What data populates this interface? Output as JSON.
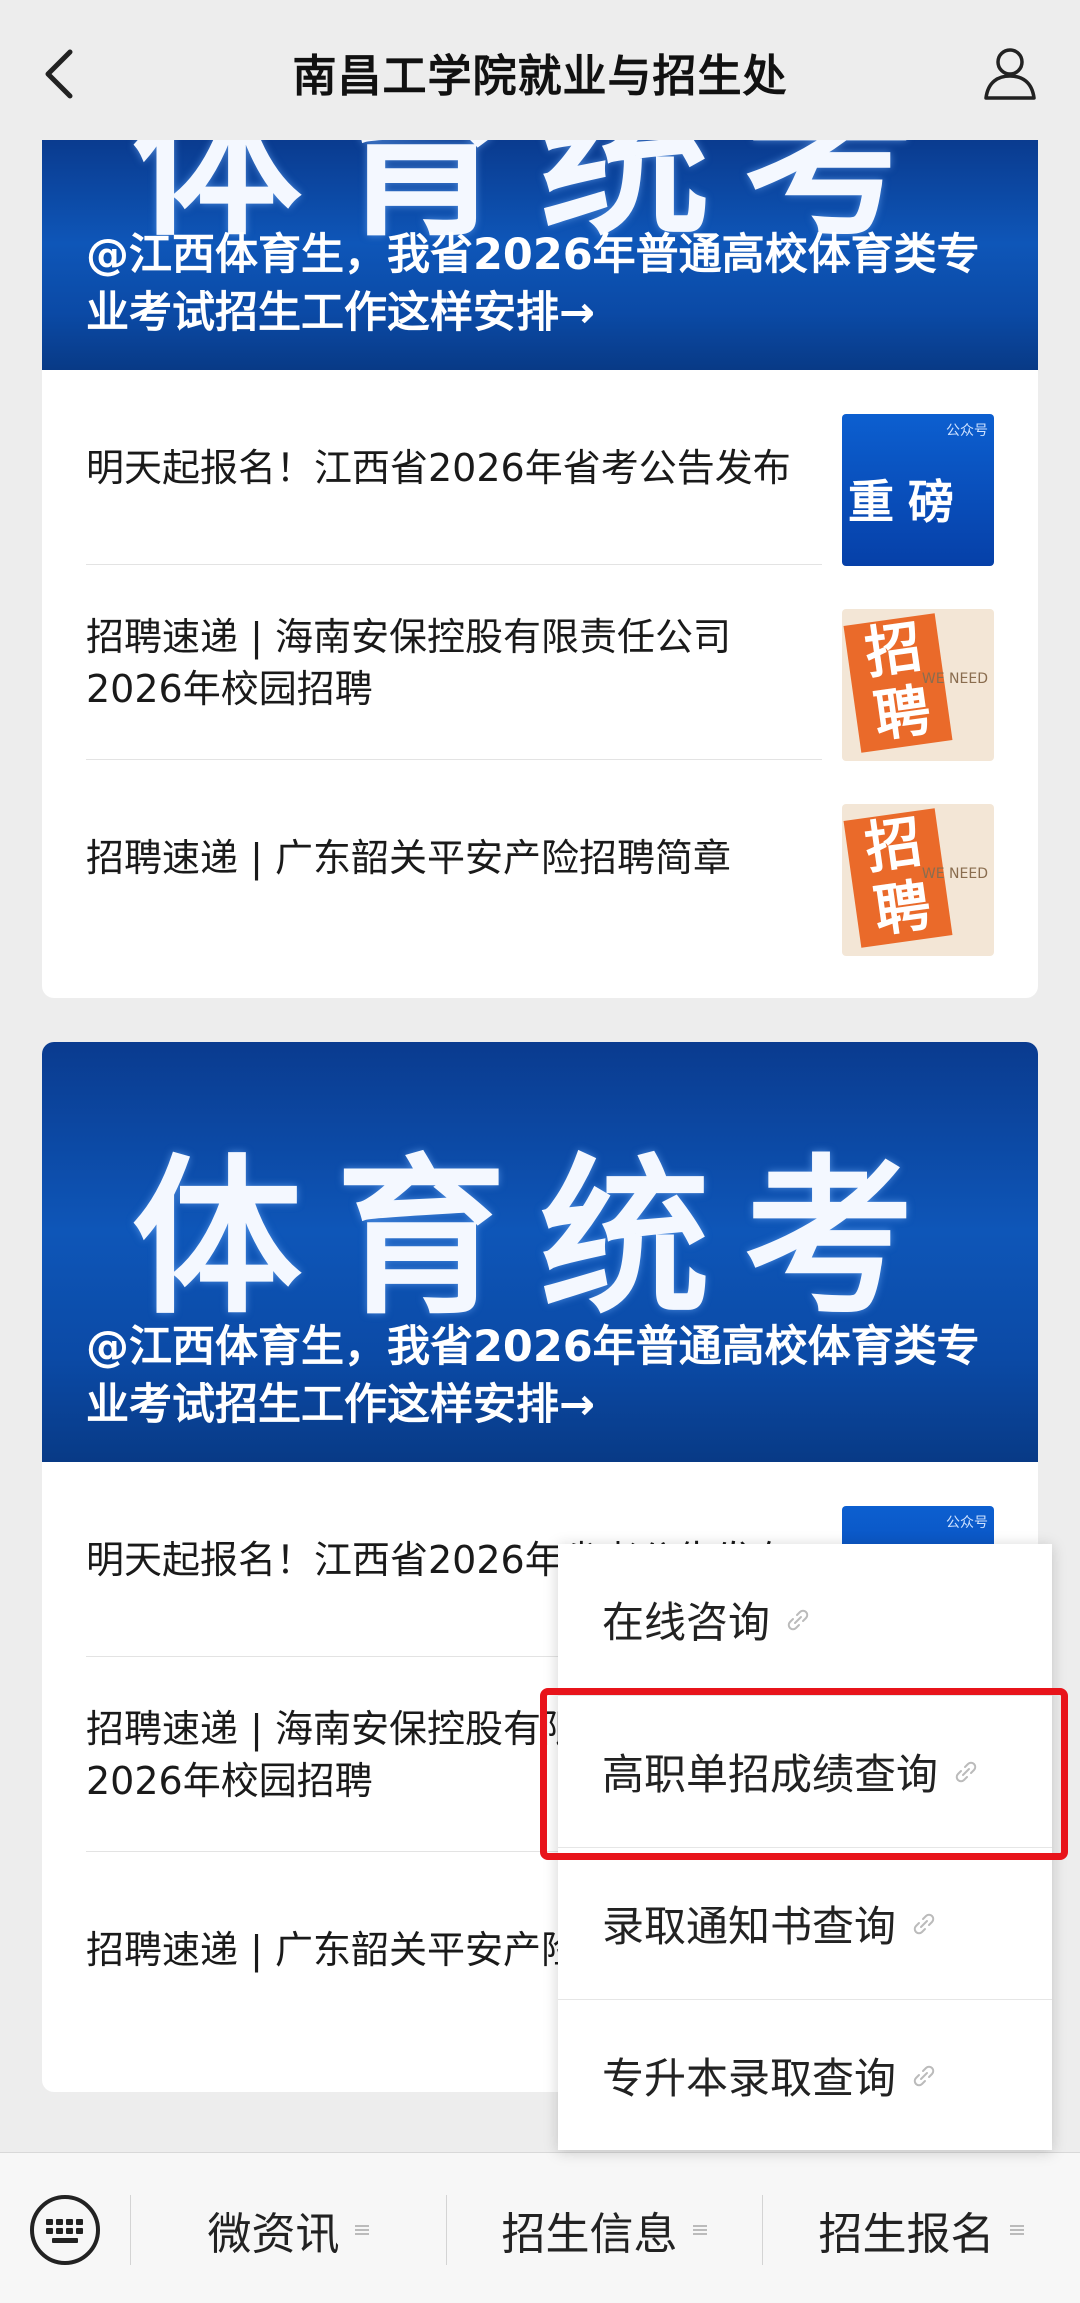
{
  "header": {
    "title": "南昌工学院就业与招生处"
  },
  "card1": {
    "banner_text": "体育统考",
    "banner_caption": "@江西体育生，我省2026年普通高校体育类专业考试招生工作这样安排→",
    "items": [
      {
        "text": "明天起报名！江西省2026年省考公告发布",
        "thumb_text": "重磅",
        "thumb_sub": "公众号"
      },
      {
        "text": "招聘速递 | 海南安保控股有限责任公司2026年校园招聘",
        "thumb_text": "招聘",
        "thumb_sub": "WE NEED"
      },
      {
        "text": "招聘速递 | 广东韶关平安产险招聘简章",
        "thumb_text": "招聘",
        "thumb_sub": "WE NEED"
      }
    ]
  },
  "card2": {
    "banner_text": "体育统考",
    "banner_caption": "@江西体育生，我省2026年普通高校体育类专业考试招生工作这样安排→",
    "items": [
      {
        "text": "明天起报名！江西省2026年省考公告发布",
        "thumb_sub": "公众号"
      },
      {
        "text": "招聘速递 | 海南安保控股有限责任公司2026年校园招聘"
      },
      {
        "text": "招聘速递 | 广东韶关平安产险招聘简章"
      }
    ]
  },
  "popup_menu": {
    "items": [
      {
        "label": "在线咨询",
        "icon": "link-icon"
      },
      {
        "label": "高职单招成绩查询",
        "icon": "link-icon",
        "highlighted": true
      },
      {
        "label": "录取通知书查询",
        "icon": "link-icon"
      },
      {
        "label": "专升本录取查询",
        "icon": "link-icon"
      }
    ],
    "highlight_color": "#e8141b"
  },
  "bottom_bar": {
    "keyboard_icon": "keyboard-icon",
    "tabs": [
      {
        "label": "微资讯"
      },
      {
        "label": "招生信息"
      },
      {
        "label": "招生报名"
      }
    ]
  },
  "colors": {
    "banner_blue": "#0e56b8",
    "background": "#ededed"
  }
}
